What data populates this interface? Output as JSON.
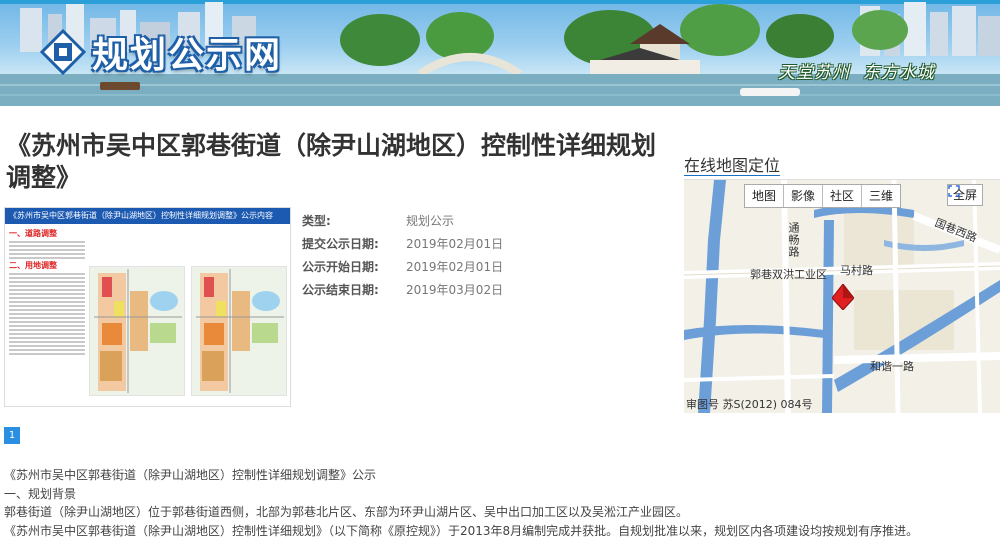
{
  "banner": {
    "site_name": "规划公示网",
    "slogan": "天堂苏州  东方水城"
  },
  "page_title": "《苏州市吴中区郭巷街道（除尹山湖地区）控制性详细规划调整》",
  "thumbnail": {
    "header": "《苏州市吴中区郭巷街道（除尹山湖地区）控制性详细规划调整》公示内容",
    "section1": "一、道路调整",
    "section2": "二、用地调整"
  },
  "info": [
    {
      "label": "类型:",
      "value": "规划公示"
    },
    {
      "label": "提交公示日期:",
      "value": "2019年02月01日"
    },
    {
      "label": "公示开始日期:",
      "value": "2019年02月01日"
    },
    {
      "label": "公示结束日期:",
      "value": "2019年03月02日"
    }
  ],
  "pager": {
    "current": "1"
  },
  "map": {
    "heading": "在线地图定位",
    "tabs": [
      "地图",
      "影像",
      "社区",
      "三维"
    ],
    "fullscreen": "全屏",
    "labels": {
      "road_vertical": "通畅路",
      "industrial_zone": "郭巷双洪工业区",
      "mac_road": "马村路",
      "hexie_road": "和谐一路",
      "guoxiang_west": "国巷西路"
    },
    "credit": "审图号 苏S(2012) 084号",
    "colors": {
      "water": "#6c9ed8",
      "road": "#ffffff",
      "marker": "#e02020",
      "land": "#f3f0e8"
    }
  },
  "body": [
    "《苏州市吴中区郭巷街道（除尹山湖地区）控制性详细规划调整》公示",
    "一、规划背景",
    "郭巷街道（除尹山湖地区）位于郭巷街道西侧，北部为郭巷北片区、东部为环尹山湖片区、吴中出口加工区以及吴淞江产业园区。",
    "《苏州市吴中区郭巷街道（除尹山湖地区）控制性详细规划》（以下简称《原控规》）于2013年8月编制完成并获批。自规划批准以来，规划区内各项建设均按规划有序推进。"
  ]
}
